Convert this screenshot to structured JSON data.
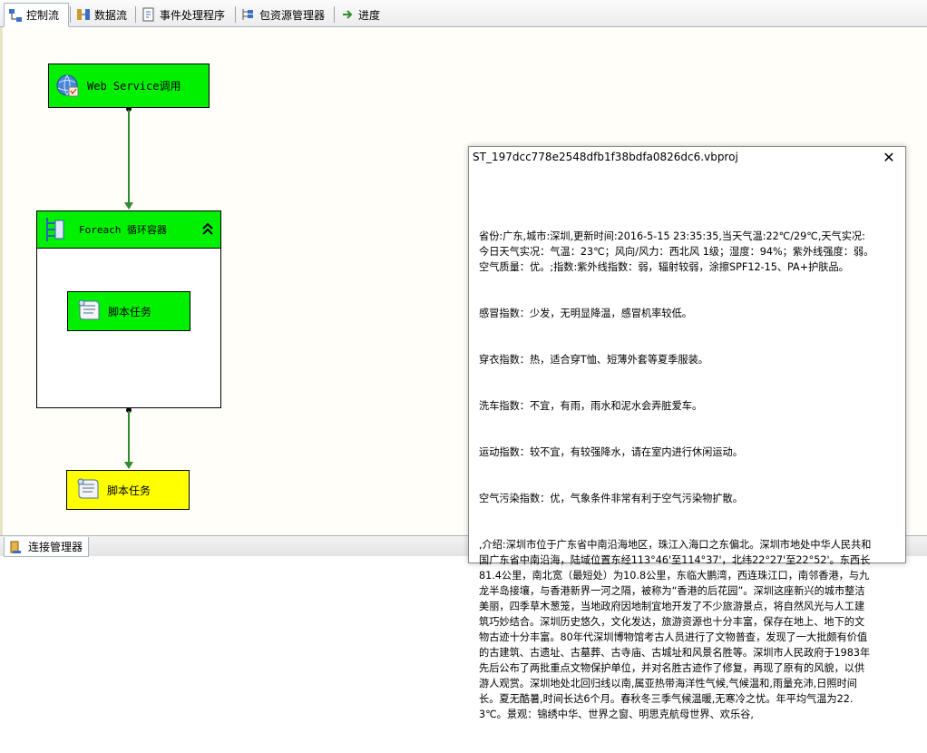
{
  "tabs": [
    {
      "label": "控制流",
      "icon": "control-flow-icon",
      "active": true
    },
    {
      "label": "数据流",
      "icon": "data-flow-icon",
      "active": false
    },
    {
      "label": "事件处理程序",
      "icon": "event-handler-icon",
      "active": false
    },
    {
      "label": "包资源管理器",
      "icon": "package-explorer-icon",
      "active": false
    },
    {
      "label": "进度",
      "icon": "progress-icon",
      "active": false
    }
  ],
  "canvas": {
    "web_service_task": {
      "label": "Web Service调用",
      "icon": "web-service-icon"
    },
    "foreach_container": {
      "label": "Foreach 循环容器",
      "icon": "foreach-icon",
      "collapse_glyph": "⌃"
    },
    "script_task_inner": {
      "label": "脚本任务",
      "icon": "script-icon"
    },
    "script_task_bottom": {
      "label": "脚本任务",
      "icon": "script-icon"
    }
  },
  "dialog": {
    "title": "ST_197dcc778e2548dfb1f38bdfa0826dc6.vbproj",
    "close_glyph": "✕",
    "lines": [
      "省份:广东,城市:深圳,更新时间:2016-5-15 23:35:35,当天气温:22℃/29℃,天气实况:今日天气实况：气温：23℃；风向/风力：西北风 1级；湿度：94%；紫外线强度：弱。空气质量：优。;指数:紫外线指数：弱，辐射较弱，涂擦SPF12-15、PA+护肤品。",
      "感冒指数：少发，无明显降温，感冒机率较低。",
      "穿衣指数：热，适合穿T恤、短薄外套等夏季服装。",
      "洗车指数：不宜，有雨，雨水和泥水会弄脏爱车。",
      "运动指数：较不宜，有较强降水，请在室内进行休闲运动。",
      "空气污染指数：优，气象条件非常有利于空气污染物扩散。",
      ",介绍:深圳市位于广东省中南沿海地区，珠江入海口之东偏北。深圳市地处中华人民共和国广东省中南沿海，陆域位置东经113°46'至114°37'，北纬22°27'至22°52'。东西长81.4公里，南北宽（最短处）为10.8公里，东临大鹏湾，西连珠江口，南邻香港，与九龙半岛接壤，与香港新界一河之隔，被称为“香港的后花园”。深圳这座新兴的城市整洁美丽，四季草木葱笼，当地政府因地制宜地开发了不少旅游景点，将自然风光与人工建筑巧妙结合。深圳历史悠久，文化发达，旅游资源也十分丰富，保存在地上、地下的文物古迹十分丰富。80年代深圳博物馆考古人员进行了文物普查，发现了一大批颇有价值的古建筑、古遗址、古墓葬、古寺庙、古城址和风景名胜等。深圳市人民政府于1983年先后公布了两批重点文物保护单位，并对名胜古迹作了修复，再现了原有的风貌，以供游人观赏。深圳地处北回归线以南,属亚热带海洋性气候,气候温和,雨量充沛,日照时间长。夏无酷暑,时间长达6个月。春秋冬三季气候温暖,无寒冷之忧。年平均气温为22.3℃。景观：锦绣中华、世界之窗、明思克航母世界、欢乐谷,"
    ]
  },
  "bottom": {
    "tab_label": "连接管理器",
    "icon": "connection-manager-icon"
  },
  "colors": {
    "task_green": "#00f000",
    "task_yellow": "#ffff00",
    "connector": "#2e8b2e"
  }
}
